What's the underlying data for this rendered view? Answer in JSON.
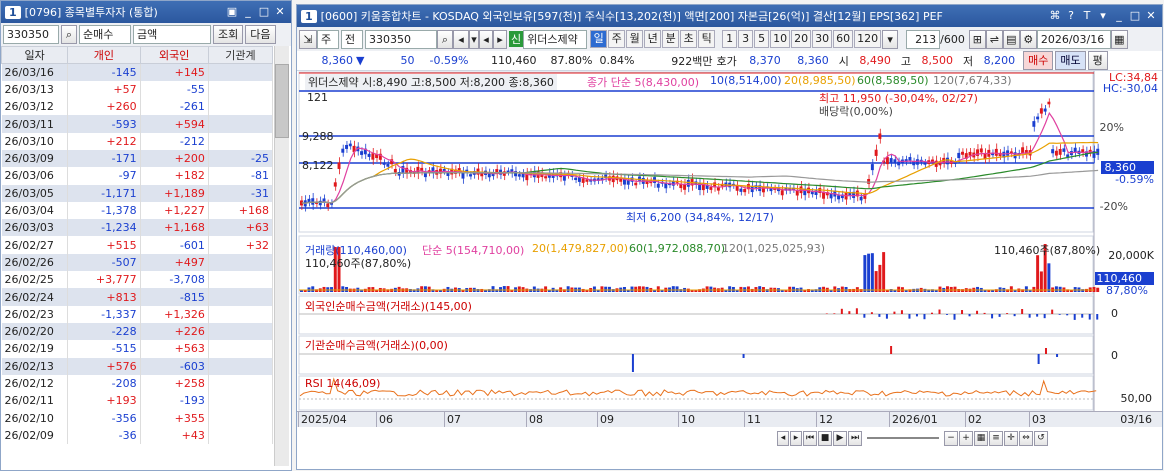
{
  "left": {
    "title_num": "1",
    "title": "[0796] 종목별투자자 (통합)",
    "code": "330350",
    "sort": "순매수",
    "unit": "금액",
    "query_btn": "조회",
    "next_btn": "다음",
    "headers": [
      "일자",
      "개인",
      "외국인",
      "기관계"
    ],
    "rows": [
      [
        "26/03/16",
        "-145",
        "+145",
        ""
      ],
      [
        "26/03/13",
        "+57",
        "-55",
        ""
      ],
      [
        "26/03/12",
        "+260",
        "-261",
        ""
      ],
      [
        "26/03/11",
        "-593",
        "+594",
        ""
      ],
      [
        "26/03/10",
        "+212",
        "-212",
        ""
      ],
      [
        "26/03/09",
        "-171",
        "+200",
        "-25"
      ],
      [
        "26/03/06",
        "-97",
        "+182",
        "-81"
      ],
      [
        "26/03/05",
        "-1,171",
        "+1,189",
        "-31"
      ],
      [
        "26/03/04",
        "-1,378",
        "+1,227",
        "+168"
      ],
      [
        "26/03/03",
        "-1,234",
        "+1,168",
        "+63"
      ],
      [
        "26/02/27",
        "+515",
        "-601",
        "+32"
      ],
      [
        "26/02/26",
        "-507",
        "+497",
        ""
      ],
      [
        "26/02/25",
        "+3,777",
        "-3,708",
        ""
      ],
      [
        "26/02/24",
        "+813",
        "-815",
        ""
      ],
      [
        "26/02/23",
        "-1,337",
        "+1,326",
        ""
      ],
      [
        "26/02/20",
        "-228",
        "+226",
        ""
      ],
      [
        "26/02/19",
        "-515",
        "+563",
        ""
      ],
      [
        "26/02/13",
        "+576",
        "-603",
        ""
      ],
      [
        "26/02/12",
        "-208",
        "+258",
        ""
      ],
      [
        "26/02/11",
        "+193",
        "-193",
        ""
      ],
      [
        "26/02/10",
        "-356",
        "+355",
        ""
      ],
      [
        "26/02/09",
        "-36",
        "+43",
        ""
      ]
    ]
  },
  "chart": {
    "title_num": "1",
    "title": "[0600] 키움종합차트 - KOSDAQ 외국인보유[597(천)] 주식수[13,202(천)] 액면[200] 자본금[26(억)] 결산[12월] EPS[362] PEF",
    "period_unit": "주",
    "period_type": "전",
    "code": "330350",
    "badge": "신",
    "name": "위더스제약",
    "periods": [
      "일",
      "주",
      "월",
      "년",
      "분",
      "초",
      "틱"
    ],
    "nums": [
      "1",
      "3",
      "5",
      "10",
      "20",
      "30",
      "60",
      "120"
    ],
    "count": "213",
    "count_total": "/600",
    "date": "2026/03/16",
    "q_price": "8,360",
    "q_arrow": "▼",
    "q_chg": "50",
    "q_pct": "-0.59%",
    "q_vol": "110,460",
    "q_volpct": "87.80%",
    "q_turn": "0.84%",
    "q_amt": "922백만",
    "hoga_lbl": "호가",
    "hoga1": "8,370",
    "hoga2": "8,360",
    "si_lbl": "시",
    "si": "8,490",
    "go_lbl": "고",
    "go": "8,500",
    "jeo_lbl": "저",
    "jeo": "8,200",
    "buy": "매수",
    "sell": "매도",
    "pyeong": "평",
    "info": "위더스제약 시:8,490 고:8,500 저:8,200 종:8,360",
    "ma_lbl": "종가 단순 5(8,430,00)",
    "ma10": "10(8,514,00)",
    "ma20": "20(8,985,50)",
    "ma60": "60(8,589,50)",
    "ma120": "120(7,674,33)",
    "lc": "LC:34,84",
    "hc": "HC:-30,04",
    "hi": "최고 11,950 (-30,04%, 02/27)",
    "lo": "최저 6,200 (34,84%, 12/17)",
    "div": "배당락(0,00%)",
    "n121": "121",
    "l9288": "9,288",
    "l8122": "8,122",
    "pct20": "20%",
    "pctm20": "-20%",
    "price_tag": "8,360",
    "pct_tag": "-0.59%",
    "vol_lbl": "거래량(110,460,00)",
    "vol_ma5": "단순 5(154,710,00)",
    "vol_ma20": "20(1,479,827,00)",
    "vol_ma60": "60(1,972,088,70)",
    "vol_ma120": "120(1,025,025,93)",
    "vol_max": "110,460주(87,80%)",
    "vol_left": "110,460주(87,80%)",
    "vol_axis": "20,000K",
    "vol_tag": "110,460",
    "vol_pct_tag": "87,80%",
    "frn_lbl": "외국인순매수금액(거래소)(145,00)",
    "frn_axis": "0",
    "ins_lbl": "기관순매수금액(거래소)(0,00)",
    "ins_axis": "0",
    "rsi_lbl": "RSI 14(46,09)",
    "rsi_axis": "50,00",
    "xlabels": [
      "2025/04",
      "06",
      "07",
      "08",
      "09",
      "10",
      "11",
      "12",
      "2026/01",
      "02",
      "03"
    ],
    "xlast": "03/16",
    "colors": {
      "up": "#e0191c",
      "down": "#1a3fd0",
      "ma5": "#e040a0",
      "ma20": "#e8a000",
      "ma60": "#2a8a2a"
    }
  }
}
